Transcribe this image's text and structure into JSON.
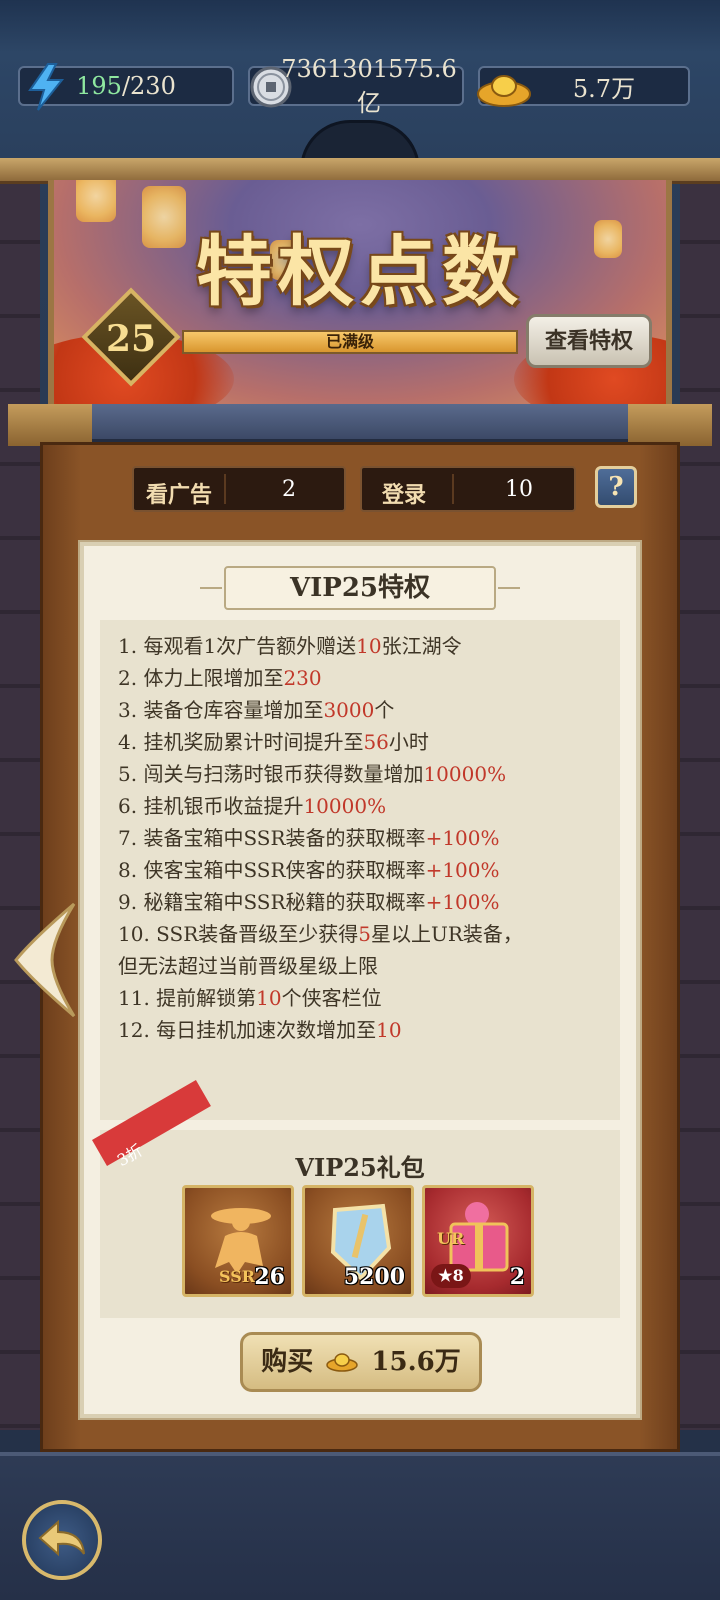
{
  "resources": {
    "stamina_current": "195",
    "stamina_max": "/230",
    "silver": "7361301575.6亿",
    "gold": "5.7万"
  },
  "banner": {
    "title": "特权点数",
    "vip_level": "25",
    "progress_label": "已满级",
    "progress_fraction": 1.0,
    "view_button": "查看特权"
  },
  "stats": {
    "ads_label": "看广告",
    "ads_value": "2",
    "login_label": "登录",
    "login_value": "10",
    "help": "?"
  },
  "privileges": {
    "title": "VIP25特权",
    "items": [
      {
        "pre": "1. 每观看1次广告额外赠送",
        "hl": "10",
        "post": "张江湖令"
      },
      {
        "pre": "2. 体力上限增加至",
        "hl": "230",
        "post": ""
      },
      {
        "pre": "3. 装备仓库容量增加至",
        "hl": "3000",
        "post": "个"
      },
      {
        "pre": "4. 挂机奖励累计时间提升至",
        "hl": "56",
        "post": "小时"
      },
      {
        "pre": "5. 闯关与扫荡时银币获得数量增加",
        "hl": "10000%",
        "post": ""
      },
      {
        "pre": "6. 挂机银币收益提升",
        "hl": "10000%",
        "post": ""
      },
      {
        "pre": "7. 装备宝箱中SSR装备的获取概率",
        "hl": "+100%",
        "post": ""
      },
      {
        "pre": "8. 侠客宝箱中SSR侠客的获取概率",
        "hl": "+100%",
        "post": ""
      },
      {
        "pre": "9. 秘籍宝箱中SSR秘籍的获取概率",
        "hl": "+100%",
        "post": ""
      },
      {
        "pre": "10. SSR装备晋级至少获得",
        "hl": "5",
        "post": "星以上UR装备，"
      },
      {
        "pre": "但无法超过当前晋级星级上限",
        "hl": "",
        "post": ""
      },
      {
        "pre": "11. 提前解锁第",
        "hl": "10",
        "post": "个侠客栏位"
      },
      {
        "pre": "12. 每日挂机加速次数增加至",
        "hl": "10",
        "post": ""
      }
    ]
  },
  "gift": {
    "title": "VIP25礼包",
    "discount": "3折",
    "items": [
      {
        "icon": "hero-silhouette-icon",
        "tag": "SSR",
        "count": "26"
      },
      {
        "icon": "shield-sword-icon",
        "tag": "",
        "count": "5200"
      },
      {
        "icon": "gift-box-icon",
        "tag": "UR",
        "stars": "8",
        "count": "2"
      }
    ],
    "buy_label": "购买",
    "price": "15.6万"
  },
  "colors": {
    "accent_red": "#c1382a",
    "gold": "#d5b466",
    "paper": "#f4efe1"
  }
}
